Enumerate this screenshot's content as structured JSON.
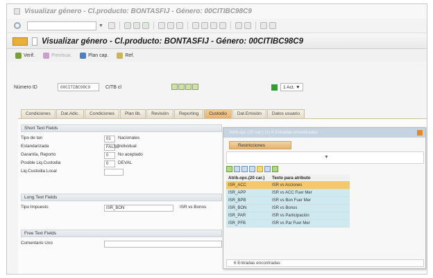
{
  "window": {
    "title": "Visualizar género - Cl.producto: BONTASFIJ - Género: 00CITIBC98C9"
  },
  "screen": {
    "title": "Visualizar género - Cl.producto: BONTASFIJ - Género: 00CITIBC98C9"
  },
  "app_toolbar": [
    {
      "label": "Verif.",
      "enabled": true
    },
    {
      "label": "Previsua.",
      "enabled": false
    },
    {
      "label": "Plan cap.",
      "enabled": true
    },
    {
      "label": "Ref.",
      "enabled": true
    }
  ],
  "header": {
    "numero_label": "Número ID",
    "numero_value": "00CITIBC98C9",
    "ctb_label": "CITB cl",
    "status_value": "1 Act."
  },
  "tabs": [
    {
      "label": "Condiciones",
      "active": false
    },
    {
      "label": "Dat.Adic.",
      "active": false
    },
    {
      "label": "Condiciones",
      "active": false
    },
    {
      "label": "Plan lib.",
      "active": false
    },
    {
      "label": "Revisión",
      "active": false
    },
    {
      "label": "Reporting",
      "active": false
    },
    {
      "label": "Custodio",
      "active": true
    },
    {
      "label": "Dat.Emisión",
      "active": false
    },
    {
      "label": "Datos usuario",
      "active": false
    }
  ],
  "short_text": {
    "title": "Short Text Fields",
    "rows": [
      {
        "label": "Tipo de tan",
        "value": "01",
        "desc": "Nacionales"
      },
      {
        "label": "Estandarizada",
        "value": "FALSE",
        "desc": "Individual"
      },
      {
        "label": "Garantía, Reporto",
        "value": "0",
        "desc": "No aceptado"
      },
      {
        "label": "Posible Liq.Custodia",
        "value": "0",
        "desc": "DEVAL"
      },
      {
        "label": "Liq.Custodia Local",
        "value": "",
        "desc": ""
      }
    ]
  },
  "long_text": {
    "title": "Long Text Fields",
    "rows": [
      {
        "label": "Tipo Impuesto",
        "value": "ISR_BON",
        "desc": "ISR vs Bonos"
      }
    ]
  },
  "free_text": {
    "title": "Free Text Fields",
    "rows": [
      {
        "label": "Comentario Uno",
        "value": ""
      }
    ]
  },
  "popup": {
    "title": "Atrib.opc.(20 car.) (1) 6 Entradas encontradas",
    "tab": "Restricciones",
    "columns": [
      "Atrib.opc.(20 car.)",
      "Texto para atributo"
    ],
    "rows": [
      {
        "code": "ISR_ACC",
        "text": "ISR vs Acciones",
        "selected": true
      },
      {
        "code": "ISR_APP",
        "text": "ISR vs ACC Fuer Mer",
        "selected": false
      },
      {
        "code": "ISR_BPB",
        "text": "ISR vs Bon Fuer Mer",
        "selected": false
      },
      {
        "code": "ISR_BON",
        "text": "ISR vs Bonos",
        "selected": false
      },
      {
        "code": "ISR_PAR",
        "text": "ISR vs Participación",
        "selected": false
      },
      {
        "code": "ISR_PFB",
        "text": "ISR vs Par Fuer Mer",
        "selected": false
      }
    ],
    "status": "6 Entradas encontradas"
  },
  "colors": {
    "accent": "#e9b46b",
    "selected_row": "#f5c96b",
    "row_bg": "#cfe9f0",
    "status_ok": "#2f9f2f"
  }
}
